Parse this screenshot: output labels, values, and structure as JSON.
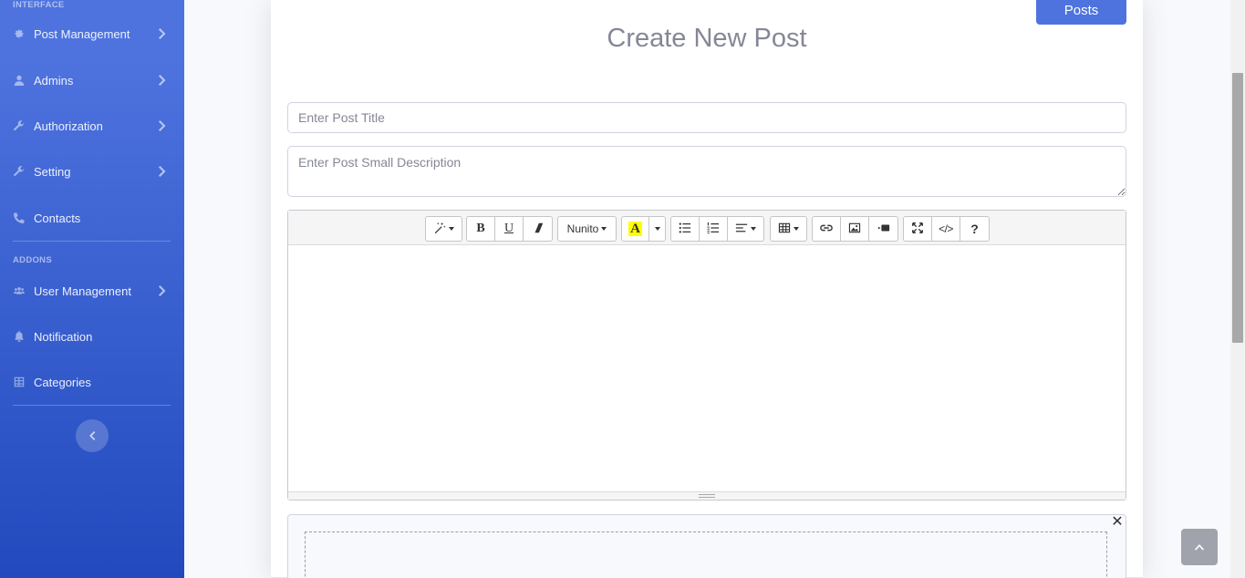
{
  "sidebar": {
    "heading_interface": "INTERFACE",
    "heading_addons": "ADDONS",
    "items": [
      {
        "label": "Post Management",
        "icon": "gear-icon",
        "has_chevron": true
      },
      {
        "label": "Admins",
        "icon": "user-icon",
        "has_chevron": true
      },
      {
        "label": "Authorization",
        "icon": "wrench-icon",
        "has_chevron": true
      },
      {
        "label": "Setting",
        "icon": "wrench-icon",
        "has_chevron": true
      },
      {
        "label": "Contacts",
        "icon": "phone-icon",
        "has_chevron": false
      },
      {
        "label": "User Management",
        "icon": "users-icon",
        "has_chevron": true
      },
      {
        "label": "Notification",
        "icon": "bell-icon",
        "has_chevron": false
      },
      {
        "label": "Categories",
        "icon": "table-icon",
        "has_chevron": false
      }
    ]
  },
  "main": {
    "posts_button": "Posts",
    "title": "Create New Post",
    "title_placeholder": "Enter Post Title",
    "description_placeholder": "Enter Post Small Description"
  },
  "editor": {
    "font_name": "Nunito",
    "tools": [
      "magic-icon",
      "bold-icon",
      "underline-icon",
      "eraser-icon",
      "font-family",
      "color-icon",
      "unordered-list-icon",
      "ordered-list-icon",
      "align-icon",
      "table-icon",
      "link-icon",
      "picture-icon",
      "video-icon",
      "fullscreen-icon",
      "code-view-icon",
      "help-icon"
    ]
  },
  "colors": {
    "primary": "#4e73df",
    "sidebar_end": "#224abe",
    "highlight": "#ffff00"
  }
}
